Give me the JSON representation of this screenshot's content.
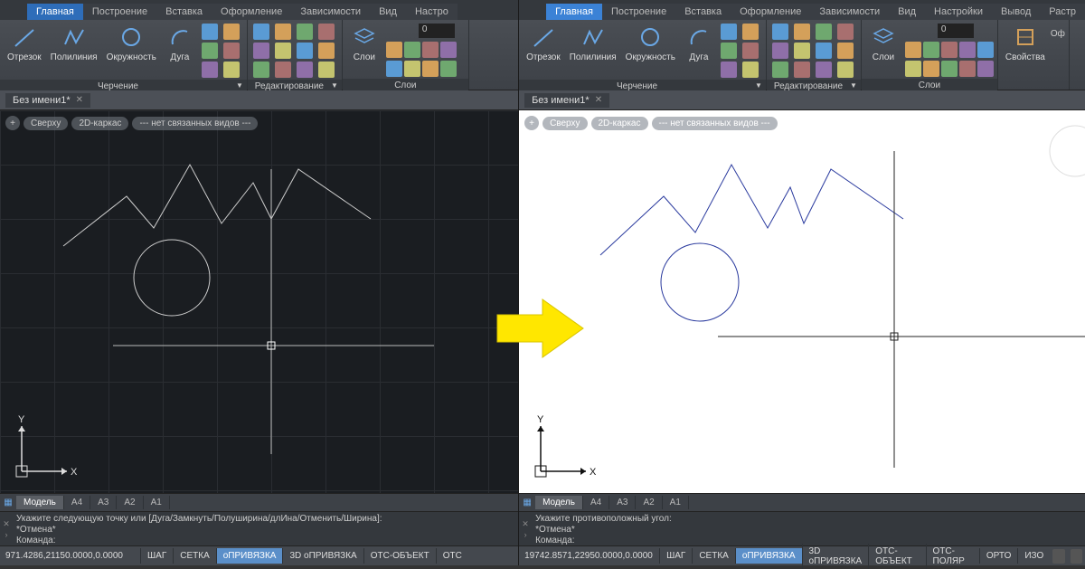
{
  "tabs": [
    "Главная",
    "Построение",
    "Вставка",
    "Оформление",
    "Зависимости",
    "Вид",
    "Настро"
  ],
  "tabs_r": [
    "Главная",
    "Построение",
    "Вставка",
    "Оформление",
    "Зависимости",
    "Вид",
    "Настройки",
    "Вывод",
    "Растр"
  ],
  "active_tab": "Главная",
  "ribbon": {
    "draw": {
      "segment": "Отрезок",
      "polyline": "Полилиния",
      "circle": "Окружность",
      "arc": "Дуга",
      "title": "Черчение"
    },
    "edit": {
      "title": "Редактирование"
    },
    "layers": {
      "title": "Слои",
      "btn": "Слои",
      "sample": "0"
    },
    "props": {
      "title": "Свойства",
      "btn": "Свойства",
      "of": "Оф"
    }
  },
  "doc_tab": "Без имени1*",
  "vp": {
    "plus": "+",
    "top": "Сверху",
    "wire": "2D-каркас",
    "nolinked": "--- нет связанных видов ---"
  },
  "layout": {
    "model": "Модель",
    "a4": "A4",
    "a3": "A3",
    "a2": "A2",
    "a1": "A1"
  },
  "cmd_left": {
    "l1": "Укажите следующую точку или [Дуга/Замкнуть/Полуширина/длИна/Отменить/Ширина]:",
    "l2": "*Отмена*",
    "l3": "Команда:"
  },
  "cmd_right": {
    "l1": "Укажите противоположный угол:",
    "l2": "*Отмена*",
    "l3": "Команда:"
  },
  "status_left": {
    "coords": "971.4286,21150.0000,0.0000",
    "btns": [
      "ШАГ",
      "СЕТКА",
      "оПРИВЯЗКА",
      "3D оПРИВЯЗКА",
      "ОТС-ОБЪЕКТ",
      "ОТС"
    ]
  },
  "status_right": {
    "coords": "19742.8571,22950.0000,0.0000",
    "btns": [
      "ШАГ",
      "СЕТКА",
      "оПРИВЯЗКА",
      "3D оПРИВЯЗКА",
      "ОТС-ОБЪЕКТ",
      "ОТС-ПОЛЯР",
      "ОРТО",
      "ИЗО"
    ]
  },
  "axis": {
    "x": "X",
    "y": "Y"
  }
}
